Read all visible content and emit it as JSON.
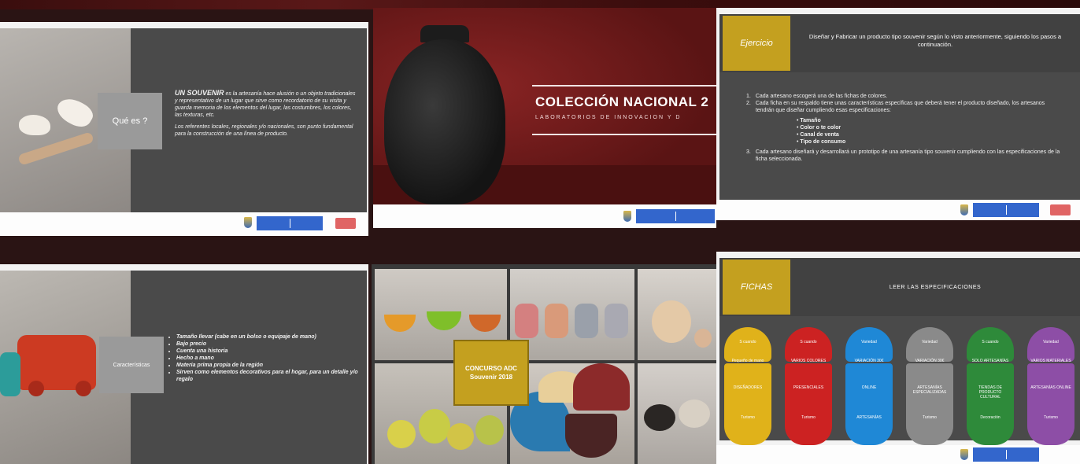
{
  "slides": {
    "souvenir": {
      "box_label": "Qué es ?",
      "heading": "UN SOUVENIR",
      "para1": "es la artesanía hace alusión o un objeto tradicionales y representativo de un lugar que sirve como recordatorio de su visita y guarda memoria de los elementos del lugar, las costumbres, los colores, las texturas, etc.",
      "para2": "Los referentes locales, regionales y/o nacionales, son punto fundamental para la construcción de una línea de producto."
    },
    "cover": {
      "title": "COLECCIÓN NACIONAL 2",
      "subtitle": "LABORATORIOS DE INNOVACIÓN Y D"
    },
    "ejercicio": {
      "tag": "Ejercicio",
      "heading": "Diseñar y Fabricar un producto tipo souvenir según lo visto anteriormente, siguiendo los pasos a continuación.",
      "steps": [
        "Cada artesano escogerá una de las fichas de colores.",
        "Cada ficha en su respaldo tiene unas características específicas que deberá tener el producto diseñado, los artesanos tendrán que diseñar cumpliendo esas especificaciones:",
        "Cada artesano diseñará y desarrollará un prototipo de una artesanía tipo souvenir cumpliendo con las especificaciones de la ficha seleccionada."
      ],
      "bullets": [
        "Tamaño",
        "Color o te color",
        "Canal de venta",
        "Tipo de consumo"
      ]
    },
    "caracteristicas": {
      "box_label": "Características",
      "items": [
        "Tamaño Ilevar (cabe en un bolso o equipaje de mano)",
        "Bajo precio",
        "Cuenta una historia",
        "Hecho a mano",
        "Materia prima propia de la región",
        "Sirven como elementos decorativos para el hogar, para un detalle y/o regalo"
      ]
    },
    "concurso": {
      "label": "CONCURSO ADC Souvenir 2018"
    },
    "fichas": {
      "tag": "FICHAS",
      "heading": "LEER LAS ESPECIFICACIONES",
      "cards": [
        {
          "color": "#e0b21a",
          "top": "S cuando",
          "mid": "Pequeño de mano",
          "low": "DISEÑADORES",
          "bot": "Turismo"
        },
        {
          "color": "#cc2222",
          "top": "S cuando",
          "mid": "VARIOS COLORES",
          "low": "PRESENCIALES",
          "bot": "Turismo"
        },
        {
          "color": "#1f88d6",
          "top": "Variedad",
          "mid": "VARIACIÓN 30€",
          "low": "ONLINE",
          "bot": "ARTESANÍAS"
        },
        {
          "color": "#8a8a8a",
          "top": "Variedad",
          "mid": "VARIACIÓN 30€",
          "low": "ARTESANÍAS ESPECIALIZADAS",
          "bot": "Turismo"
        },
        {
          "color": "#2e8a3a",
          "top": "S cuando",
          "mid": "SOLO ARTESANÍAS",
          "low": "TIENDAS DE PRODUCTO CULTURAL",
          "bot": "Decoración"
        },
        {
          "color": "#8d4ea6",
          "top": "Variedad",
          "mid": "VARIOS MATERIALES",
          "low": "ARTESANÍAS ONLINE",
          "bot": "Turismo"
        }
      ]
    }
  },
  "colors": {
    "dark_panel": "#4a4a4a",
    "gold": "#c4a01f",
    "gov_blue": "#3366cc",
    "maroon": "#6e1a1a"
  },
  "icons": [
    "colombia-shield-icon",
    "gov-logo-icon",
    "red-logo-icon"
  ]
}
